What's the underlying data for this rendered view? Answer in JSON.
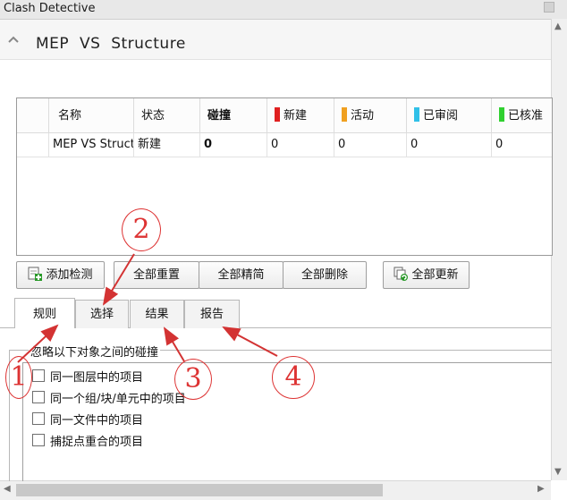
{
  "window": {
    "title": "Clash Detective"
  },
  "test": {
    "title": "MEP  VS  Structure"
  },
  "grid": {
    "headers": {
      "name": "名称",
      "status": "状态",
      "clashes": "碰撞",
      "new": "新建",
      "active": "活动",
      "reviewed": "已审阅",
      "approved": "已核准"
    },
    "row": {
      "name": "MEP  VS  Structure",
      "status": "新建",
      "clashes": "0",
      "new": "0",
      "active": "0",
      "reviewed": "0",
      "approved": "0"
    },
    "status_colors": {
      "new": "#e02020",
      "active": "#f0a020",
      "reviewed": "#30c0e8",
      "approved": "#30d030"
    }
  },
  "buttons": {
    "add_test": "添加检测",
    "reset_all": "全部重置",
    "compact_all": "全部精简",
    "delete_all": "全部删除",
    "update_all": "全部更新"
  },
  "tabs": {
    "rules": "规则",
    "select": "选择",
    "results": "结果",
    "report": "报告"
  },
  "rules": {
    "group_title": "忽略以下对象之间的碰撞",
    "options": [
      "同一图层中的项目",
      "同一个组/块/单元中的项目",
      "同一文件中的项目",
      "捕捉点重合的项目"
    ]
  },
  "annotations": [
    "1",
    "2",
    "3",
    "4"
  ],
  "accent": {
    "annotation_red": "#d33333"
  }
}
